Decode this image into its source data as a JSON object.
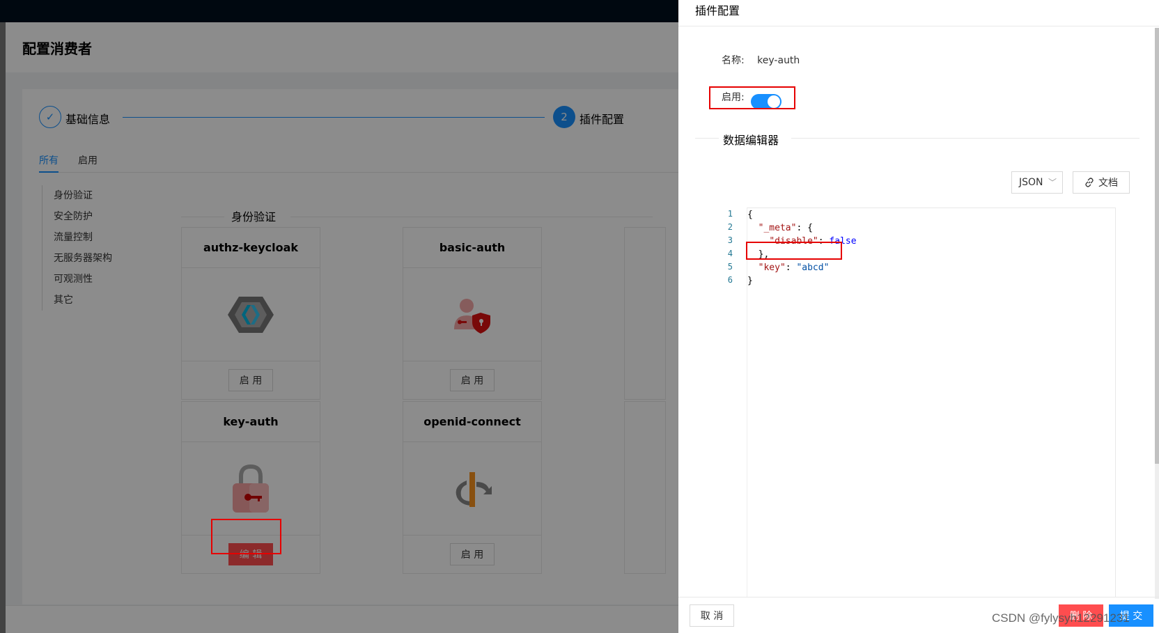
{
  "page": {
    "title": "配置消费者",
    "steps": [
      {
        "label": "基础信息",
        "status": "done"
      },
      {
        "label": "插件配置",
        "number": "2",
        "status": "active"
      }
    ],
    "tabs": [
      "所有",
      "启用"
    ],
    "categories": [
      "身份验证",
      "安全防护",
      "流量控制",
      "无服务器架构",
      "可观测性",
      "其它"
    ],
    "section_title": "身份验证",
    "plugins": [
      {
        "name": "authz-keycloak",
        "icon": "keycloak-icon",
        "button": "启 用"
      },
      {
        "name": "basic-auth",
        "icon": "user-shield-icon",
        "button": "启 用"
      },
      {
        "name": "key-auth",
        "icon": "padlock-key-icon",
        "button": "编 辑"
      },
      {
        "name": "openid-connect",
        "icon": "openid-icon",
        "button": "启 用"
      }
    ]
  },
  "drawer": {
    "title": "插件配置",
    "name_label": "名称:",
    "name_value": "key-auth",
    "enable_label": "启用:",
    "enabled": true,
    "editor_section": "数据编辑器",
    "format_select": "JSON",
    "doc_button": "文档",
    "code_lines": [
      "1",
      "2",
      "3",
      "4",
      "5",
      "6"
    ],
    "cancel": "取 消",
    "delete": "删 除",
    "submit": "提 交"
  },
  "watermark": "CSDN @fylysyh12291231",
  "colors": {
    "primary": "#1890ff",
    "danger": "#ff4d4f",
    "highlight": "#e60000"
  }
}
